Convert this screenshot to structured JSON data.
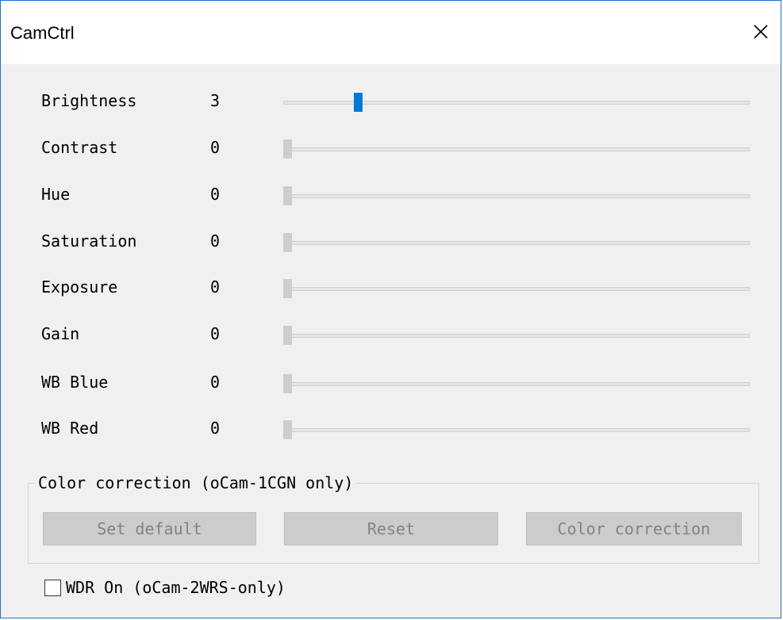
{
  "window": {
    "title": "CamCtrl",
    "close_icon": "close-icon"
  },
  "controls": [
    {
      "label": "Brightness",
      "value": "3",
      "slider_fraction": 0.155,
      "active": true
    },
    {
      "label": "Contrast",
      "value": "0",
      "slider_fraction": 0,
      "active": false
    },
    {
      "label": "Hue",
      "value": "0",
      "slider_fraction": 0,
      "active": false
    },
    {
      "label": "Saturation",
      "value": "0",
      "slider_fraction": 0,
      "active": false
    },
    {
      "label": "Exposure",
      "value": "0",
      "slider_fraction": 0,
      "active": false
    },
    {
      "label": "Gain",
      "value": "0",
      "slider_fraction": 0,
      "active": false
    },
    {
      "label": "WB Blue",
      "value": "0",
      "slider_fraction": 0,
      "active": false
    },
    {
      "label": "WB Red",
      "value": "0",
      "slider_fraction": 0,
      "active": false
    }
  ],
  "color_correction": {
    "group_label": "Color correction (oCam-1CGN only)",
    "set_default_label": "Set default",
    "reset_label": "Reset",
    "color_correction_label": "Color correction"
  },
  "wdr": {
    "label": "WDR On (oCam-2WRS-only)",
    "checked": false
  },
  "colors": {
    "accent": "#0078d7",
    "window_border": "#1e6fd0",
    "background": "#f0f0f0"
  }
}
